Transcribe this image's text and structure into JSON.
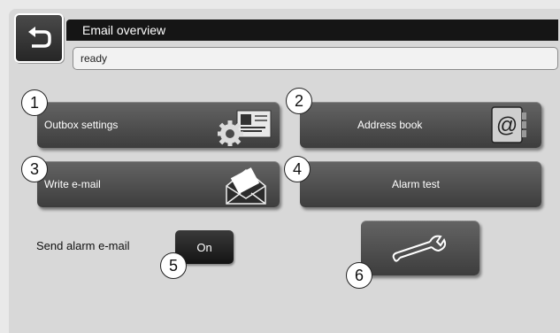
{
  "header": {
    "title": "Email overview",
    "status": "ready",
    "back_icon": "back-arrow-icon"
  },
  "buttons": {
    "outbox": {
      "label": "Outbox settings",
      "icon": "gear-envelope-icon"
    },
    "address_book": {
      "label": "Address book",
      "icon": "at-book-icon"
    },
    "write": {
      "label": "Write e-mail",
      "icon": "open-envelope-icon"
    },
    "alarm_test": {
      "label": "Alarm test"
    }
  },
  "send_alarm": {
    "label": "Send alarm e-mail",
    "value": "On"
  },
  "service": {
    "icon": "wrench-icon"
  },
  "callouts": [
    "1",
    "2",
    "3",
    "4",
    "5",
    "6"
  ],
  "colors": {
    "title_bar": "#151515",
    "button": "#4f4f4f",
    "panel": "#d8d8d8"
  }
}
